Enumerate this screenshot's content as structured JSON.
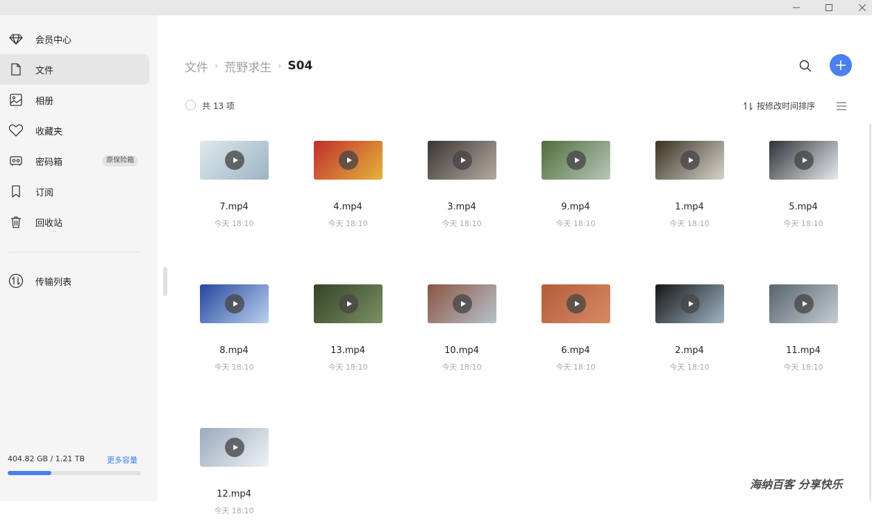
{
  "titlebar": {
    "min_icon": "minimize-icon",
    "max_icon": "maximize-icon",
    "close_icon": "close-icon"
  },
  "sidebar": {
    "items": [
      {
        "label": "会员中心",
        "icon": "diamond-icon"
      },
      {
        "label": "文件",
        "icon": "file-icon",
        "active": true
      },
      {
        "label": "相册",
        "icon": "album-icon"
      },
      {
        "label": "收藏夹",
        "icon": "heart-icon"
      },
      {
        "label": "密码箱",
        "icon": "safe-icon",
        "badge": "原保险箱"
      },
      {
        "label": "订阅",
        "icon": "bookmark-icon"
      },
      {
        "label": "回收站",
        "icon": "trash-icon"
      }
    ],
    "transfer": {
      "label": "传输列表",
      "icon": "transfer-icon"
    },
    "storage": {
      "used_text": "404.82 GB / 1.21 TB",
      "more_label": "更多容量",
      "fraction": 0.33
    }
  },
  "breadcrumb": [
    "文件",
    "荒野求生",
    "S04"
  ],
  "toolbar": {
    "count_text": "共 13 项",
    "sort_label": "按修改时间排序"
  },
  "colors": {
    "accent": "#4c7ff0",
    "sidebar_bg": "#f5f5f5",
    "active_bg": "#e6e6e6"
  },
  "files": [
    {
      "name": "7.mp4",
      "time": "今天 18:10",
      "thumb": [
        "#dfe8ee",
        "#9cb4c4"
      ]
    },
    {
      "name": "4.mp4",
      "time": "今天 18:10",
      "thumb": [
        "#c22e2e",
        "#e3b43a"
      ]
    },
    {
      "name": "3.mp4",
      "time": "今天 18:10",
      "thumb": [
        "#3b3633",
        "#b4aaa2"
      ]
    },
    {
      "name": "9.mp4",
      "time": "今天 18:10",
      "thumb": [
        "#4f6e3c",
        "#b8c6b8"
      ]
    },
    {
      "name": "1.mp4",
      "time": "今天 18:10",
      "thumb": [
        "#3a3221",
        "#d6d4ce"
      ]
    },
    {
      "name": "5.mp4",
      "time": "今天 18:10",
      "thumb": [
        "#2d3338",
        "#e6ebee"
      ]
    },
    {
      "name": "8.mp4",
      "time": "今天 18:10",
      "thumb": [
        "#2746a0",
        "#b9d2ec"
      ]
    },
    {
      "name": "13.mp4",
      "time": "今天 18:10",
      "thumb": [
        "#324428",
        "#7d9062"
      ]
    },
    {
      "name": "10.mp4",
      "time": "今天 18:10",
      "thumb": [
        "#8c5542",
        "#b6c2cc"
      ]
    },
    {
      "name": "6.mp4",
      "time": "今天 18:10",
      "thumb": [
        "#b45c3c",
        "#d58a62"
      ]
    },
    {
      "name": "2.mp4",
      "time": "今天 18:10",
      "thumb": [
        "#151616",
        "#9eb4c4"
      ]
    },
    {
      "name": "11.mp4",
      "time": "今天 18:10",
      "thumb": [
        "#58646e",
        "#c6ccd2"
      ]
    },
    {
      "name": "12.mp4",
      "time": "今天 18:10",
      "thumb": [
        "#9aaabc",
        "#eef2f6"
      ]
    }
  ],
  "watermark": "海纳百客 分享快乐"
}
